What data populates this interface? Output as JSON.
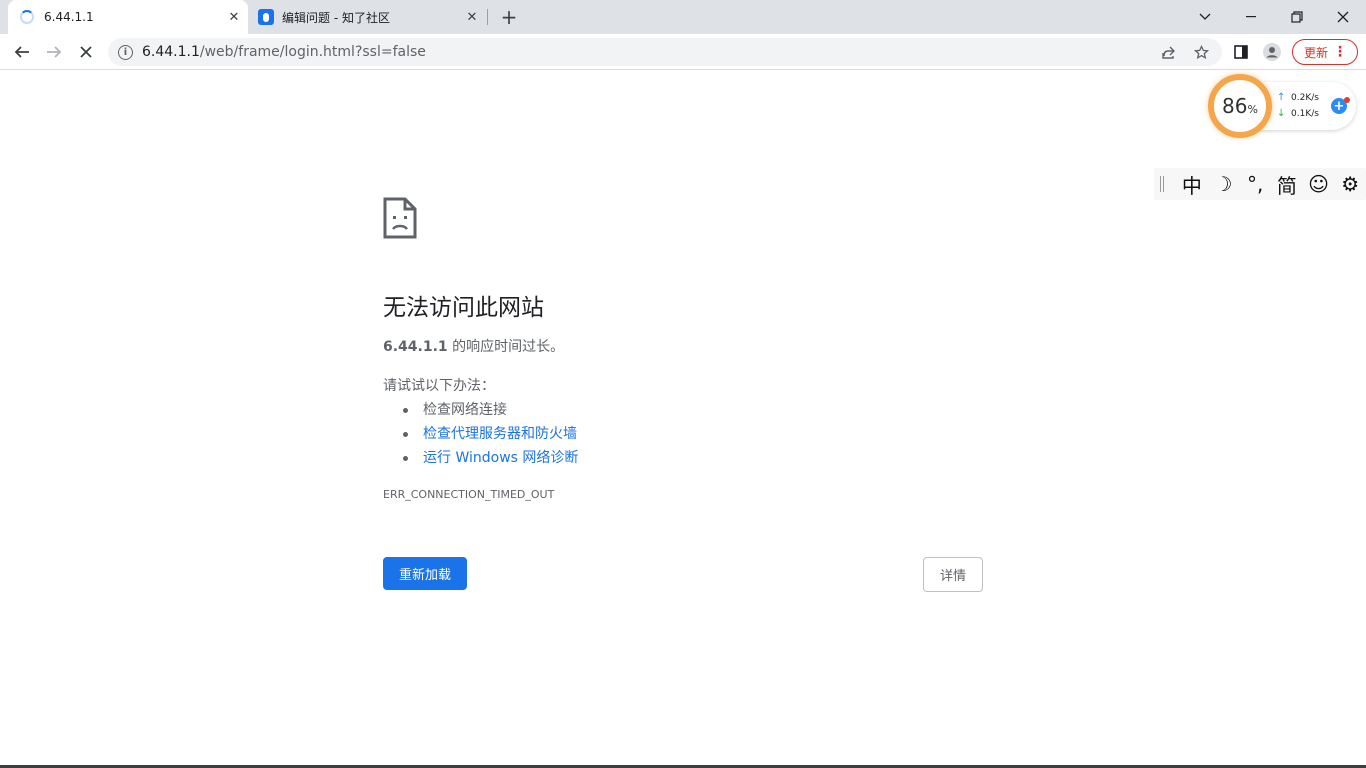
{
  "tabs": [
    {
      "title": "6.44.1.1",
      "icon": "loading-spinner",
      "close": "✕"
    },
    {
      "title": "编辑问题 - 知了社区",
      "icon": "zhiliao-favicon",
      "close": "✕"
    }
  ],
  "newtab": "+",
  "window_controls": {
    "dropdown": "⌄",
    "minimize": "—",
    "restore": "❐",
    "close": "✕"
  },
  "toolbar": {
    "back": "←",
    "forward": "→",
    "stop": "✕",
    "url_host": "6.44.1.1",
    "url_rest": "/web/frame/login.html?ssl=false",
    "update_label": "更新",
    "menu": "⋮"
  },
  "netwidget": {
    "percent": "86",
    "percent_unit": "%",
    "up_speed": "0.2K/s",
    "down_speed": "0.1K/s",
    "up_arrow": "↑",
    "down_arrow": "↓",
    "plus": "+"
  },
  "ime": {
    "keys": [
      "中",
      "☽",
      "°,",
      "简",
      "☺",
      "⚙"
    ]
  },
  "error": {
    "title": "无法访问此网站",
    "host": "6.44.1.1",
    "desc_suffix": " 的响应时间过长。",
    "try_label": "请试试以下办法：",
    "suggestions": [
      {
        "text": "检查网络连接",
        "link": false
      },
      {
        "text": "检查代理服务器和防火墙",
        "link": true
      },
      {
        "text": "运行 Windows 网络诊断",
        "link": true
      }
    ],
    "code": "ERR_CONNECTION_TIMED_OUT",
    "reload_label": "重新加载",
    "details_label": "详情"
  },
  "colors": {
    "accent": "#1a73e8",
    "update_red": "#d93025",
    "gauge_orange": "#f5a54a"
  }
}
